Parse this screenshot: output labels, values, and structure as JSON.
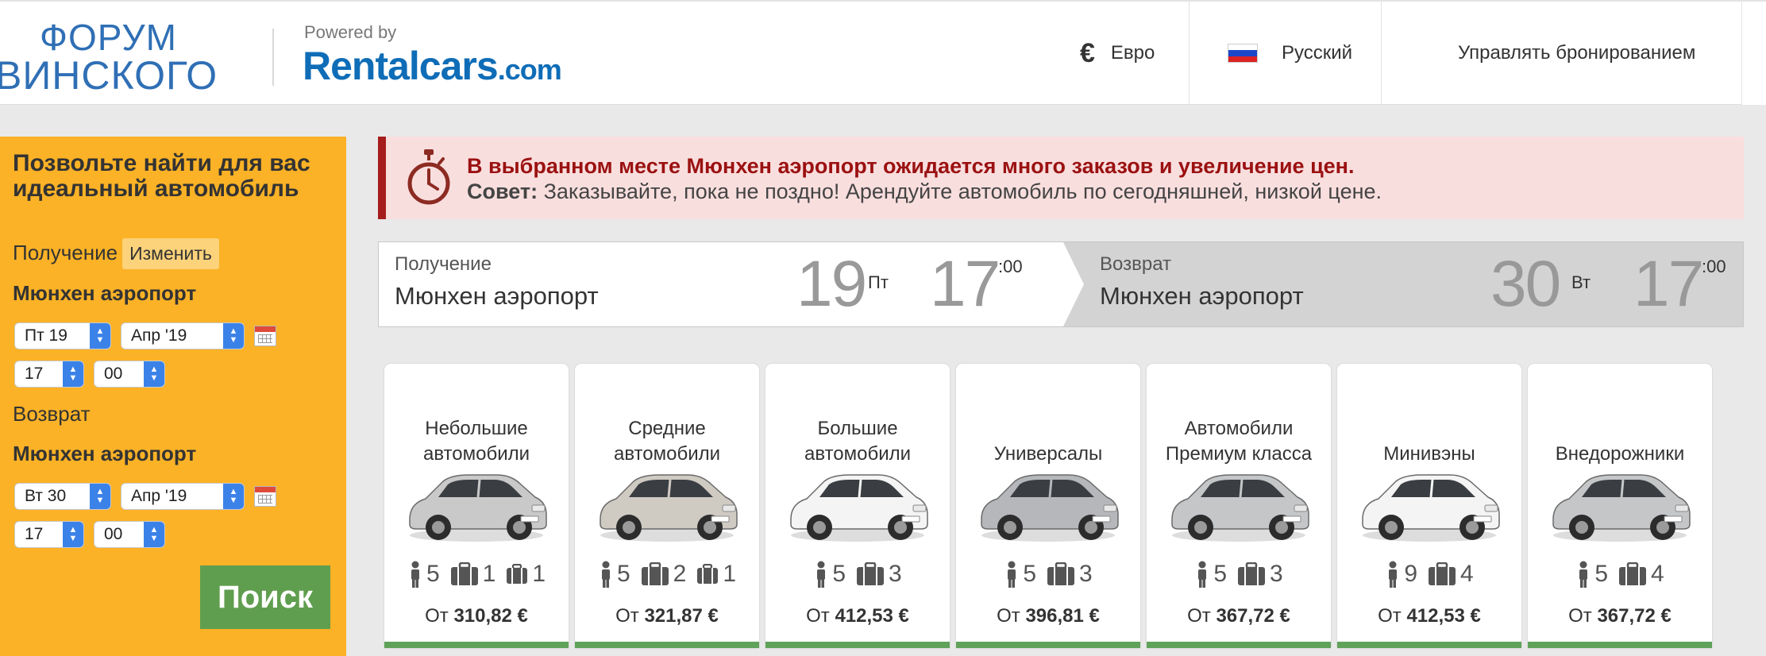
{
  "header": {
    "forum_logo_line1": "ФОРУМ",
    "forum_logo_line2": "ВИНСКОГО",
    "powered_by": "Powered by",
    "rentalcars_logo": "Rentalcars",
    "rentalcars_logo_suffix": ".com",
    "currency_symbol": "€",
    "currency": "Евро",
    "language": "Русский",
    "manage_booking": "Управлять бронированием",
    "flag_colors": [
      "#ffffff",
      "#1c48c8",
      "#dd2222"
    ]
  },
  "sidebar": {
    "title": "Позвольте найти для вас идеальный автомобиль",
    "pickup_label": "Получение",
    "change_label": "Изменить",
    "pickup_place": "Мюнхен аэропорт",
    "pickup_day": "Пт 19",
    "pickup_month": "Апр '19",
    "pickup_hour": "17",
    "pickup_minute": "00",
    "return_label": "Возврат",
    "return_place": "Мюнхен аэропорт",
    "return_day": "Вт 30",
    "return_month": "Апр '19",
    "return_hour": "17",
    "return_minute": "00",
    "search_label": "Поиск"
  },
  "alert": {
    "headline": "В выбранном месте Мюнхен аэропорт ожидается много заказов и увеличение цен.",
    "tip_bold": "Совет:",
    "tip_text": "Заказывайте, пока не поздно! Арендуйте автомобиль по сегодняшней, низкой цене."
  },
  "dates": {
    "pickup": {
      "label": "Получение",
      "place": "Мюнхен аэропорт",
      "day": "19",
      "weekday": "Пт",
      "hour": "17",
      "minutes": ":00"
    },
    "return": {
      "label": "Возврат",
      "place": "Мюнхен аэропорт",
      "day": "30",
      "weekday": "Вт",
      "hour": "17",
      "minutes": ":00"
    }
  },
  "cards": [
    {
      "name": "Небольшие автомобили",
      "seats": "5",
      "bags_large": "1",
      "bags_small": "1",
      "price_prefix": "От",
      "price": "310,82 €",
      "car_color": "#c9c9c9"
    },
    {
      "name": "Средние автомобили",
      "seats": "5",
      "bags_large": "2",
      "bags_small": "1",
      "price_prefix": "От",
      "price": "321,87 €",
      "car_color": "#cfcac2"
    },
    {
      "name": "Большие автомобили",
      "seats": "5",
      "bags_large": "3",
      "price_prefix": "От",
      "price": "412,53 €",
      "car_color": "#f4f4f4"
    },
    {
      "name": "Универсалы",
      "seats": "5",
      "bags_large": "3",
      "price_prefix": "От",
      "price": "396,81 €",
      "car_color": "#b5b7ba"
    },
    {
      "name": "Автомобили Премиум класса",
      "seats": "5",
      "bags_large": "3",
      "price_prefix": "От",
      "price": "367,72 €",
      "car_color": "#c4c6c8"
    },
    {
      "name": "Минивэны",
      "seats": "9",
      "bags_large": "4",
      "price_prefix": "От",
      "price": "412,53 €",
      "car_color": "#f4f4f4"
    },
    {
      "name": "Внедорожники",
      "seats": "5",
      "bags_large": "4",
      "price_prefix": "От",
      "price": "367,72 €",
      "car_color": "#c4c6c8"
    }
  ]
}
